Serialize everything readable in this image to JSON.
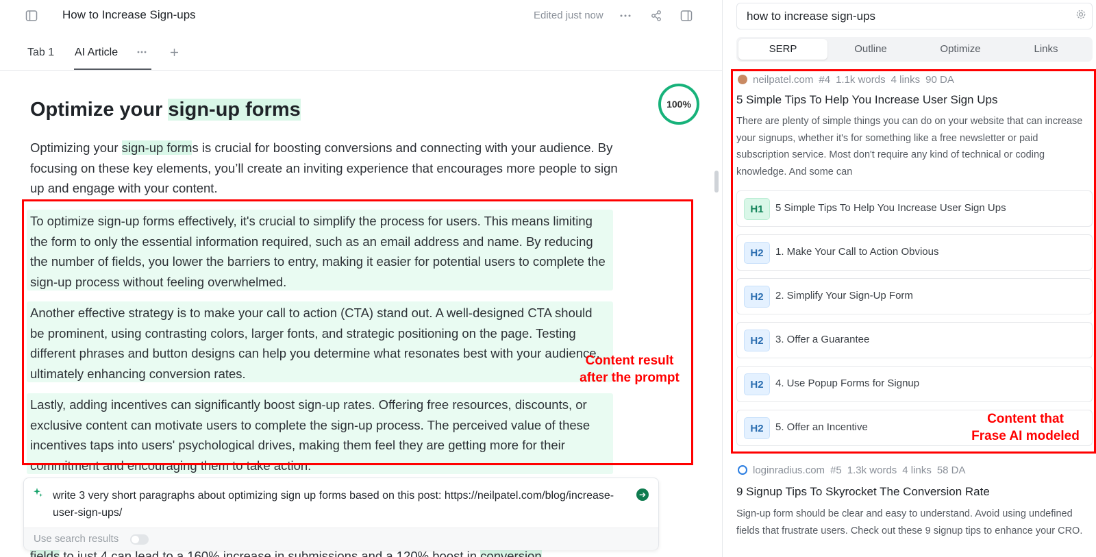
{
  "editor": {
    "doc_title": "How to Increase Sign-ups",
    "status": "Edited just now",
    "tabs": [
      {
        "label": "Tab 1"
      },
      {
        "label": "AI Article"
      }
    ],
    "score": "100%",
    "heading_plain": "Optimize your ",
    "heading_highlight": "sign-up forms",
    "intro_pre": "Optimizing your ",
    "intro_highlight": "sign-up form",
    "intro_post": "s is crucial for boosting conversions and connecting with your audience. By focusing on these key elements, you’ll create an inviting experience that encourages more people to sign up and engage with your content.",
    "paragraphs": [
      "To optimize sign-up forms effectively, it's crucial to simplify the process for users. This means limiting the form to only the essential information required, such as an email address and name. By reducing the number of fields, you lower the barriers to entry, making it easier for potential users to complete the sign-up process without feeling overwhelmed.",
      "Another effective strategy is to make your call to action (CTA) stand out. A well-designed CTA should be prominent, using contrasting colors, larger fonts, and strategic positioning on the page. Testing different phrases and button designs can help you determine what resonates best with your audience, ultimately enhancing conversion rates.",
      "Lastly, adding incentives can significantly boost sign-up rates. Offering free resources, discounts, or exclusive content can motivate users to complete the sign-up process. The perceived value of these incentives taps into users' psychological drives, making them feel they are getting more for their commitment and encouraging them to take action."
    ],
    "annotation_left": "Content result\nafter the prompt",
    "prompt_text": "write 3 very short paragraphs about optimizing sign up forms based on this post: https://neilpatel.com/blog/increase-user-sign-ups/",
    "use_search_label": "Use search results",
    "use_search_enabled": false,
    "below_text_pre": "fields",
    "below_text_mid": " to just 4 can lead to a 160% increase in submissions and a 120% boost in ",
    "below_text_post": "conversion"
  },
  "serp": {
    "query": "how to increase sign-ups",
    "tabs": [
      "SERP",
      "Outline",
      "Optimize",
      "Links"
    ],
    "active_tab": "SERP",
    "annotation_right": "Content that\nFrase AI modeled",
    "results": [
      {
        "domain": "neilpatel.com",
        "rank": "#4",
        "words": "1.1k words",
        "links": "4 links",
        "da": "90 DA",
        "title": "5 Simple Tips To Help You Increase User Sign Ups",
        "snippet": "There are plenty of simple things you can do on your website that can increase your signups, whether it's for something like a free newsletter or paid subscription service. Most don't require any kind of technical or coding knowledge. And some can",
        "headings": [
          {
            "level": "H1",
            "text": "5 Simple Tips To Help You Increase User Sign Ups"
          },
          {
            "level": "H2",
            "text": "1. Make Your Call to Action Obvious"
          },
          {
            "level": "H2",
            "text": "2. Simplify Your Sign-Up Form"
          },
          {
            "level": "H2",
            "text": "3. Offer a Guarantee"
          },
          {
            "level": "H2",
            "text": "4. Use Popup Forms for Signup"
          },
          {
            "level": "H2",
            "text": "5. Offer an Incentive"
          }
        ]
      },
      {
        "domain": "loginradius.com",
        "rank": "#5",
        "words": "1.3k words",
        "links": "4 links",
        "da": "58 DA",
        "title": "9 Signup Tips To Skyrocket The Conversion Rate",
        "snippet": "Sign-up form should be clear and easy to understand. Avoid using undefined fields that frustrate users. Check out these 9 signup tips to enhance your CRO."
      }
    ]
  },
  "colors": {
    "annotation": "#ff0000",
    "highlight": "#d9f7e8",
    "paragraph_bg": "#e9fbf2",
    "score_ring": "#17b27a"
  },
  "icons": [
    "sidebar-toggle-icon",
    "more-icon",
    "share-icon",
    "panel-icon",
    "add-tab-icon",
    "sparkle-icon",
    "send-icon",
    "gear-icon",
    "favicon-icon"
  ]
}
